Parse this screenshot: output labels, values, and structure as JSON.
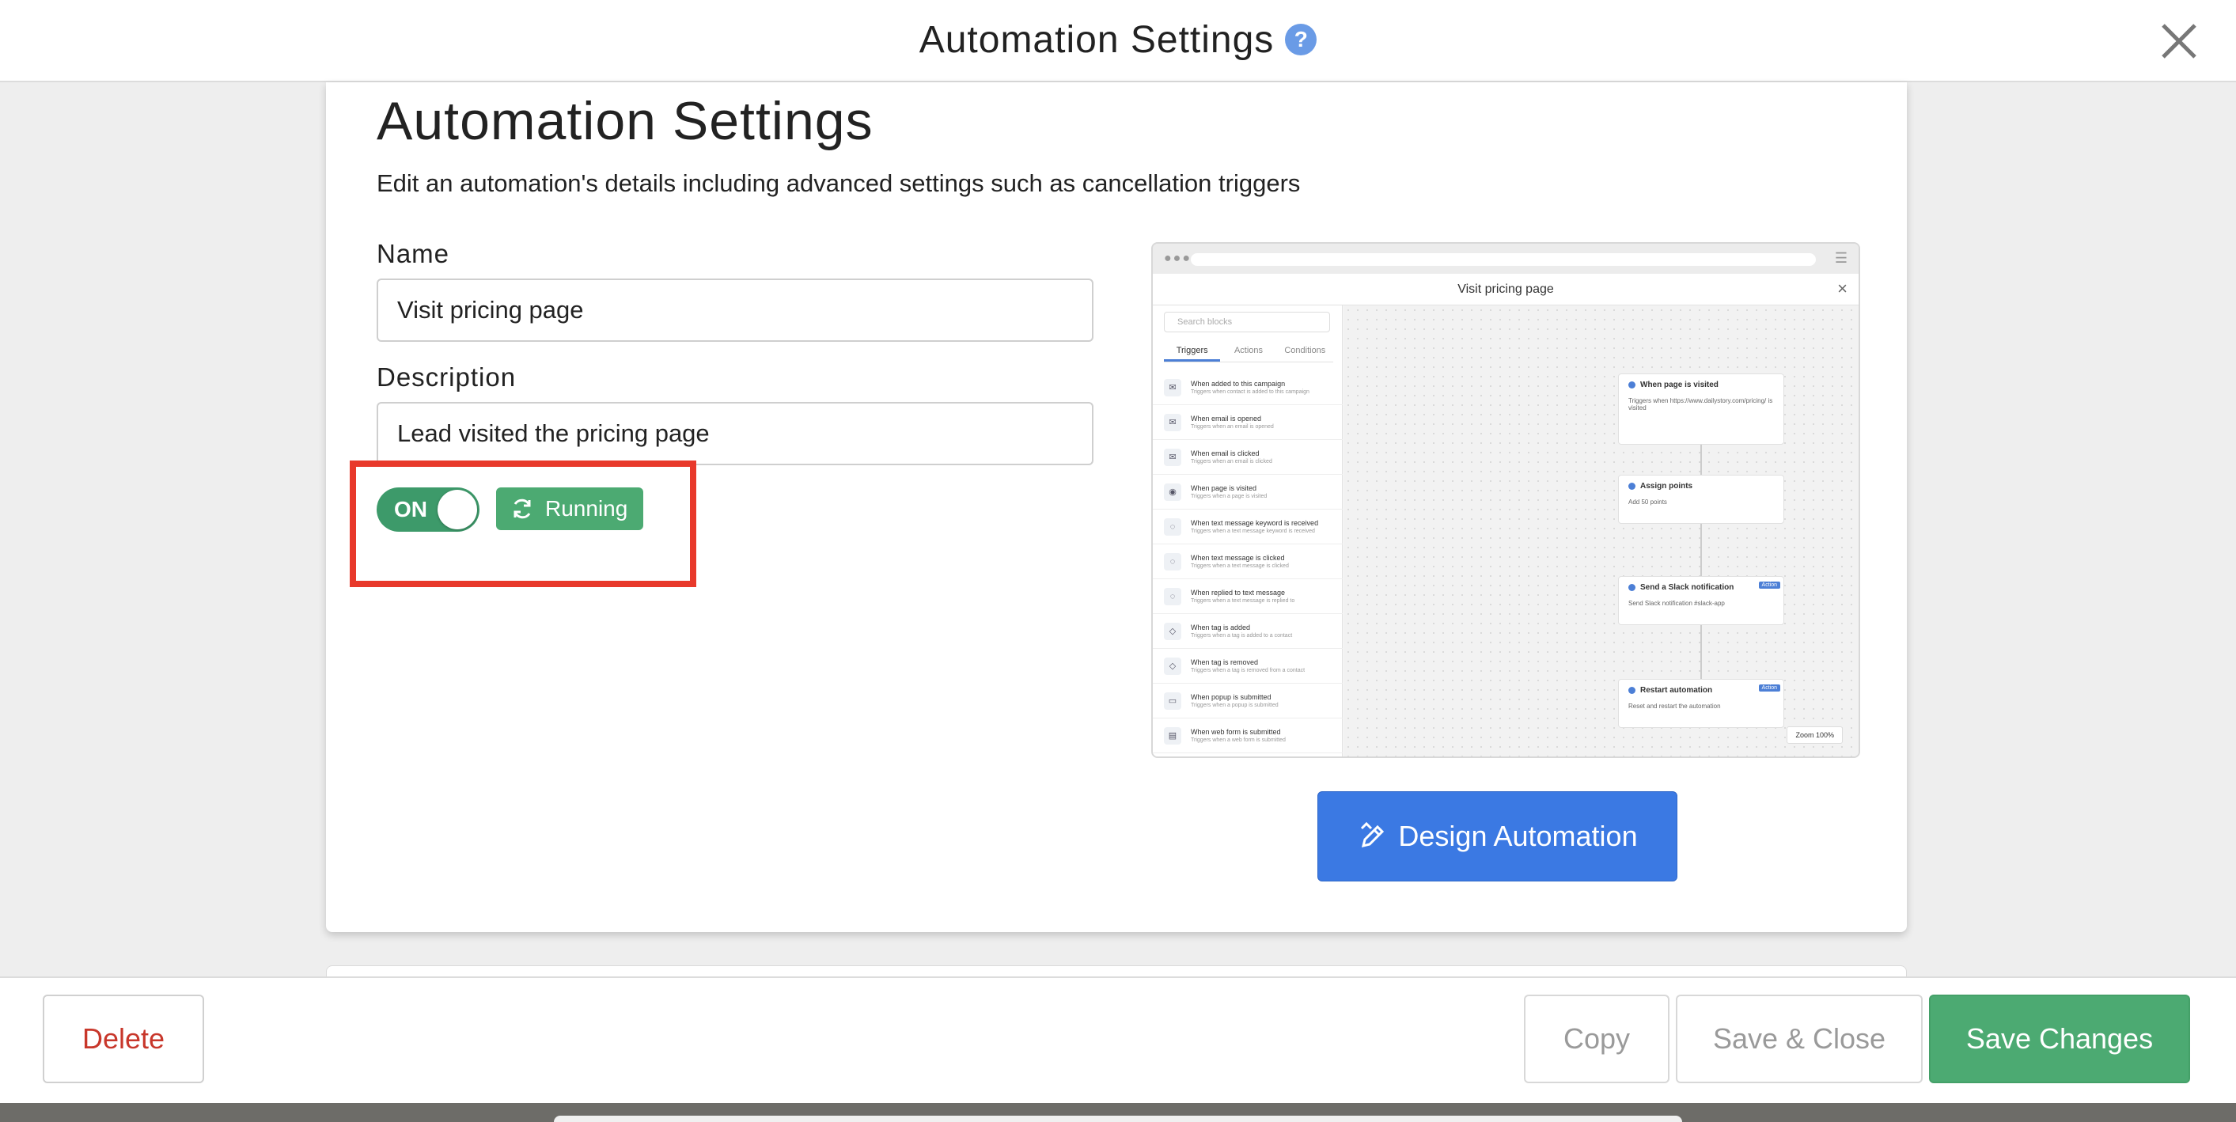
{
  "header": {
    "title": "Automation Settings",
    "help_icon": "?"
  },
  "page": {
    "title": "Automation Settings",
    "subtitle": "Edit an automation's details including advanced settings such as cancellation triggers"
  },
  "form": {
    "name_label": "Name",
    "name_value": "Visit pricing page",
    "description_label": "Description",
    "description_value": "Lead visited the pricing page"
  },
  "status": {
    "toggle_label": "ON",
    "toggle_on": true,
    "badge": "Running",
    "badge_icon": "refresh-icon",
    "toggle_color": "#3d9a6a",
    "badge_color": "#4caa72",
    "highlight_color": "#e8392b"
  },
  "preview": {
    "title": "Visit pricing page",
    "search_placeholder": "Search blocks",
    "tabs": [
      "Triggers",
      "Actions",
      "Conditions"
    ],
    "list": [
      {
        "title": "When added to this campaign",
        "sub": "Triggers when contact is added to this campaign",
        "icon": "megaphone-icon"
      },
      {
        "title": "When email is opened",
        "sub": "Triggers when an email is opened",
        "icon": "envelope-open-icon"
      },
      {
        "title": "When email is clicked",
        "sub": "Triggers when an email is clicked",
        "icon": "email-click-icon"
      },
      {
        "title": "When page is visited",
        "sub": "Triggers when a page is visited",
        "icon": "eye-icon"
      },
      {
        "title": "When text message keyword is received",
        "sub": "Triggers when a text message keyword is received",
        "icon": "chat-icon"
      },
      {
        "title": "When text message is clicked",
        "sub": "Triggers when a text message is clicked",
        "icon": "chat-icon"
      },
      {
        "title": "When replied to text message",
        "sub": "Triggers when a text message is replied to",
        "icon": "chat-icon"
      },
      {
        "title": "When tag is added",
        "sub": "Triggers when a tag is added to a contact",
        "icon": "tag-icon"
      },
      {
        "title": "When tag is removed",
        "sub": "Triggers when a tag is removed from a contact",
        "icon": "tag-icon"
      },
      {
        "title": "When popup is submitted",
        "sub": "Triggers when a popup is submitted",
        "icon": "window-icon"
      },
      {
        "title": "When web form is submitted",
        "sub": "Triggers when a web form is submitted",
        "icon": "form-icon"
      }
    ],
    "nodes": [
      {
        "title": "When page is visited",
        "body": "Triggers when https://www.dailystory.com/pricing/ is visited",
        "badge": ""
      },
      {
        "title": "Assign points",
        "body": "Add 50 points",
        "badge": ""
      },
      {
        "title": "Send a Slack notification",
        "body": "Send Slack notification #slack-app",
        "badge": "Action"
      },
      {
        "title": "Restart automation",
        "body": "Reset and restart the automation",
        "badge": "Action"
      }
    ],
    "zoom": "Zoom 100%"
  },
  "design_button": "Design Automation",
  "footer": {
    "delete": "Delete",
    "copy": "Copy",
    "save_close": "Save & Close",
    "save_changes": "Save Changes"
  }
}
